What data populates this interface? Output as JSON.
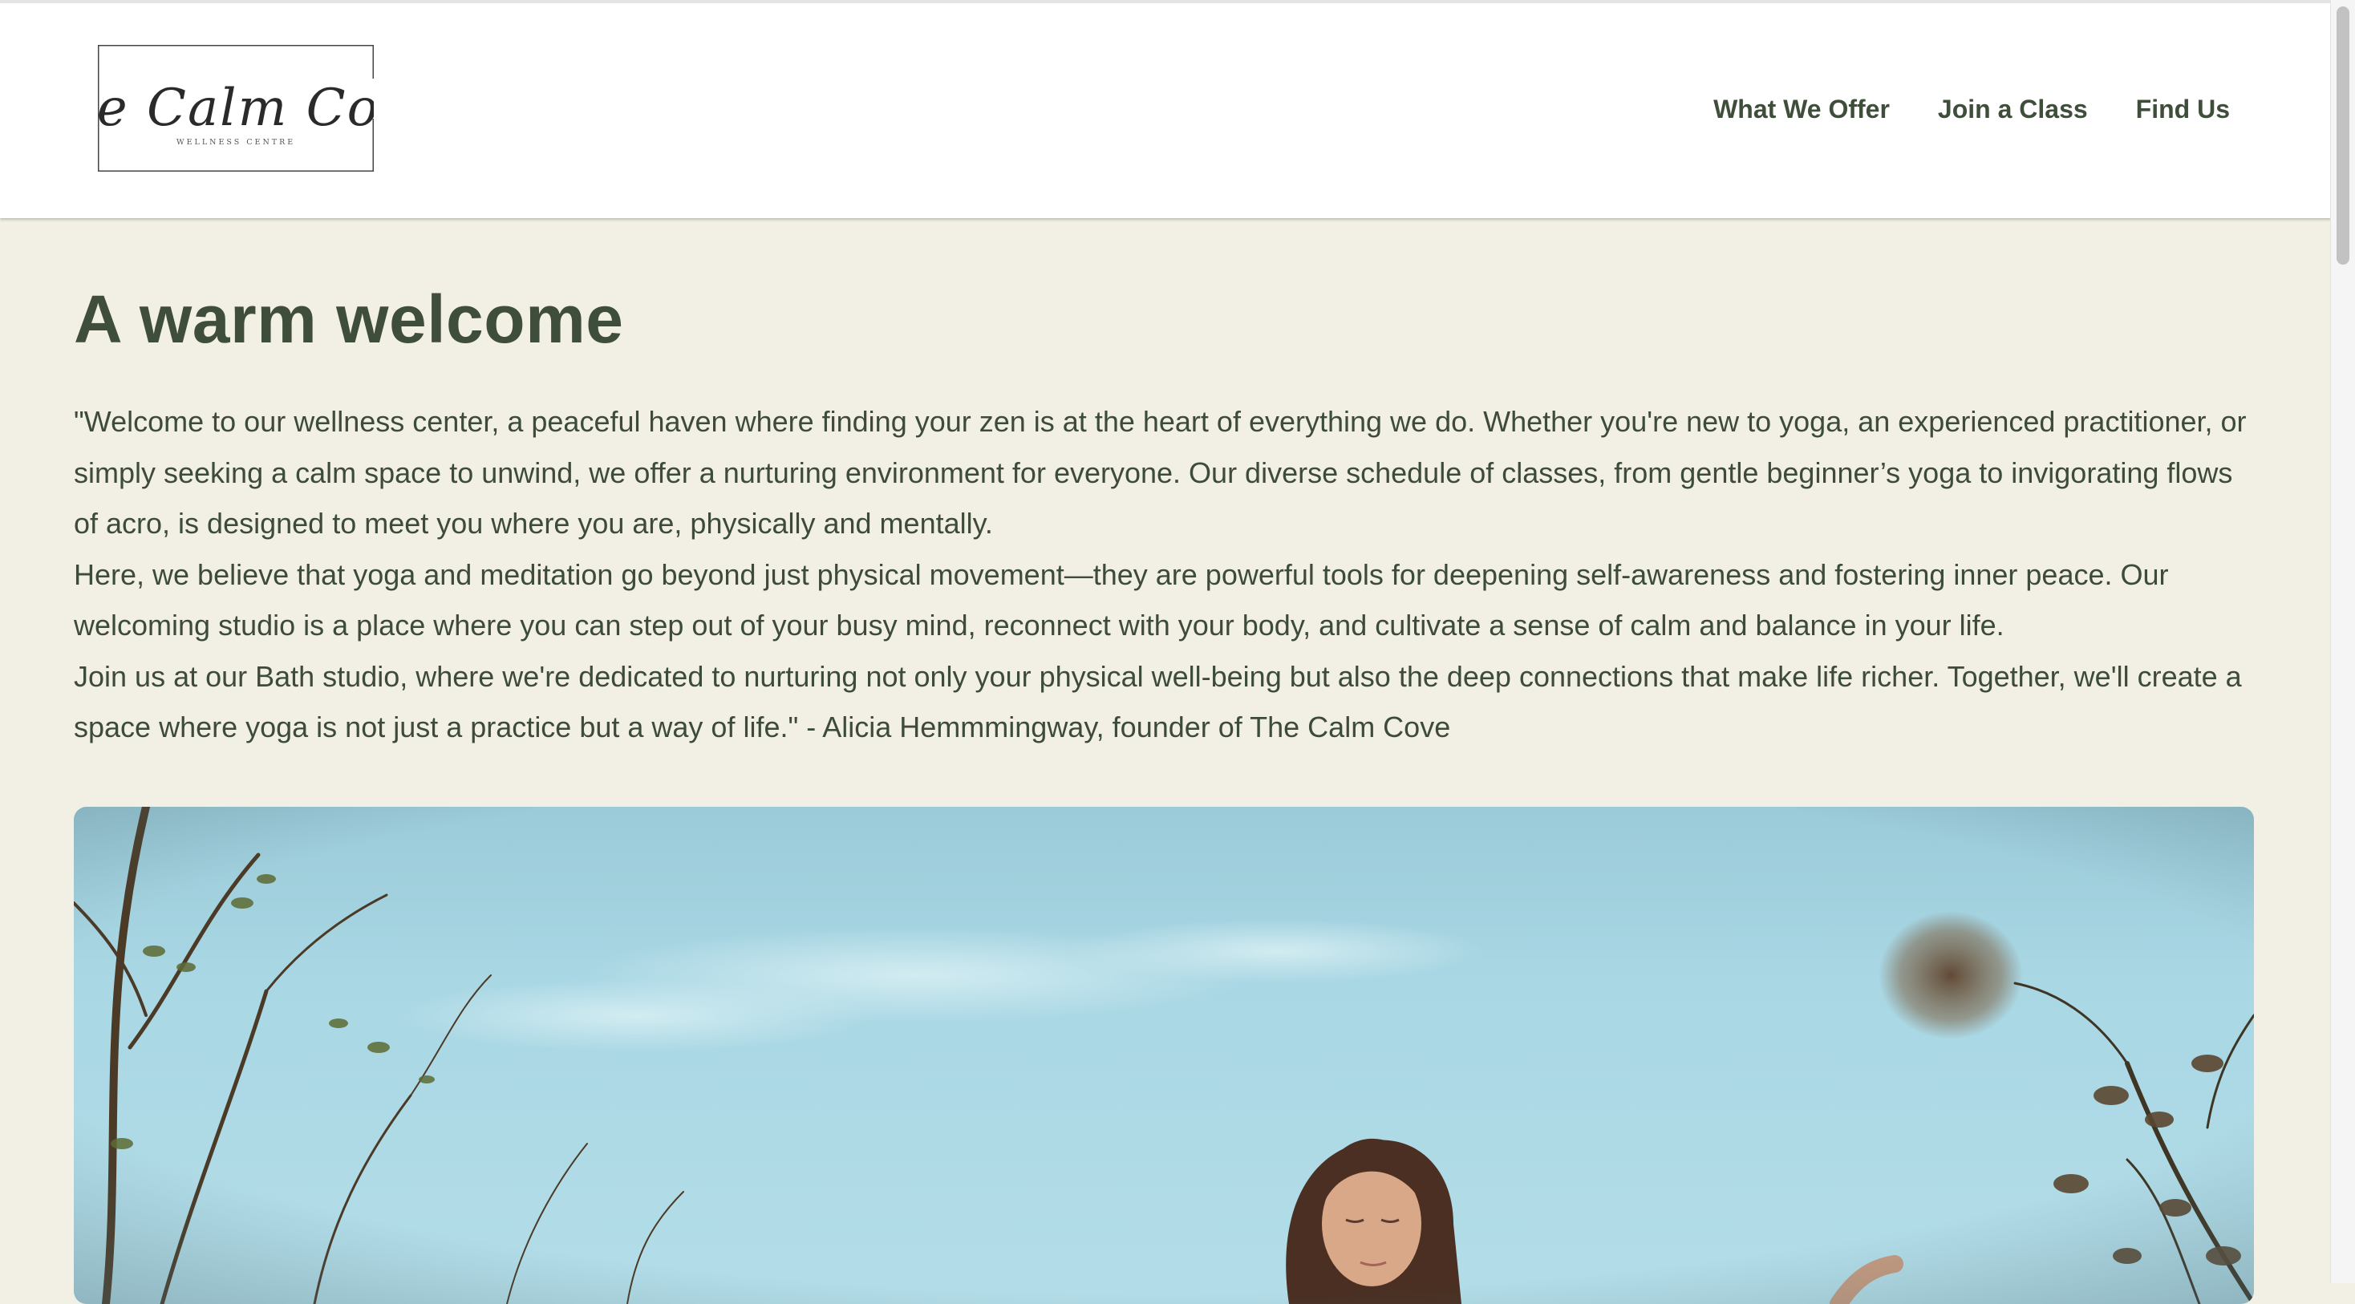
{
  "header": {
    "logo": {
      "name": "The Calm Cove",
      "tagline": "WELLNESS CENTRE"
    },
    "nav": [
      {
        "label": "What We Offer"
      },
      {
        "label": "Join a Class"
      },
      {
        "label": "Find Us"
      }
    ]
  },
  "main": {
    "title": "A warm welcome",
    "paragraphs": [
      "\"Welcome to our wellness center, a peaceful haven where finding your zen is at the heart of everything we do. Whether you're new to yoga, an experienced practitioner, or simply seeking a calm space to unwind, we offer a nurturing environment for everyone. Our diverse schedule of classes, from gentle beginner’s yoga to invigorating flows of acro, is designed to meet you where you are, physically and mentally.",
      "Here, we believe that yoga and meditation go beyond just physical movement—they are powerful tools for deepening self-awareness and fostering inner peace. Our welcoming studio is a place where you can step out of your busy mind, reconnect with your body, and cultivate a sense of calm and balance in your life.",
      "Join us at our Bath studio, where we're dedicated to nurturing not only your physical well-being but also the deep connections that make life richer. Together, we'll create a space where yoga is not just a practice but a way of life.\" - Alicia Hemmmingway, founder of The Calm Cove"
    ],
    "hero_image": "woman-meditating-outdoors-photo"
  },
  "colors": {
    "background": "#f2f0e4",
    "header_bg": "#ffffff",
    "accent_text": "#3f4e3a"
  }
}
